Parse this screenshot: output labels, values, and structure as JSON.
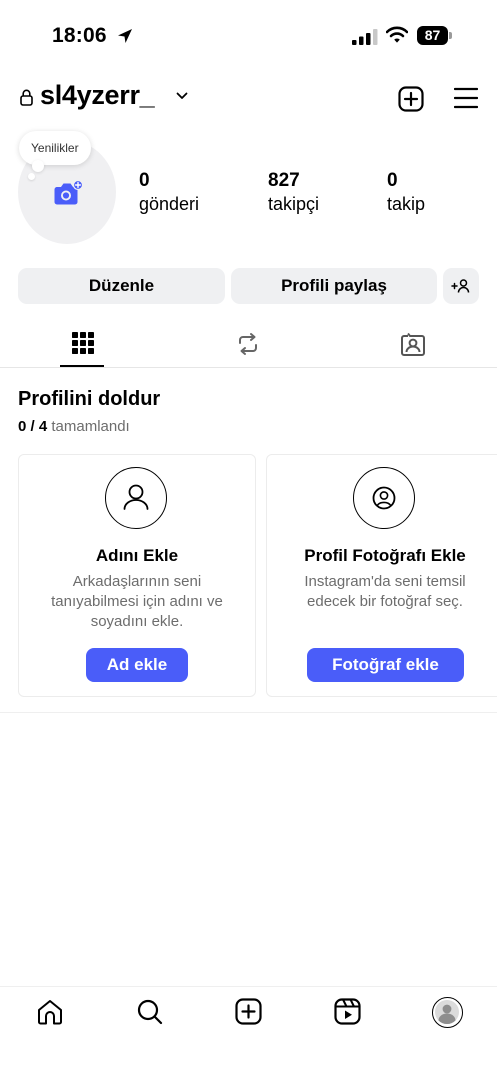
{
  "status_bar": {
    "time": "18:06",
    "battery": "87"
  },
  "header": {
    "username": "sl4yzerr_"
  },
  "profile": {
    "bubble_text": "Yenilikler",
    "stats": [
      {
        "value": "0",
        "label": "gönderi"
      },
      {
        "value": "827",
        "label": "takipçi"
      },
      {
        "value": "0",
        "label": "takip"
      }
    ]
  },
  "actions": {
    "edit_label": "Düzenle",
    "share_label": "Profili paylaş"
  },
  "tabs": [
    {
      "icon": "grid-icon",
      "active": true
    },
    {
      "icon": "reposts-icon",
      "active": false
    },
    {
      "icon": "tagged-icon",
      "active": false
    }
  ],
  "complete_profile": {
    "title": "Profilini doldur",
    "progress_count": "0 / 4",
    "progress_text": "tamamlandı",
    "cards": [
      {
        "title": "Adını Ekle",
        "lines": [
          "Arkadaşlarının seni",
          "tanıyabilmesi için adını ve",
          "soyadını ekle."
        ],
        "button": "Ad ekle"
      },
      {
        "title": "Profil Fotoğrafı Ekle",
        "lines": [
          "Instagram'da seni temsil",
          "edecek bir fotoğraf seç."
        ],
        "button": "Fotoğraf ekle"
      }
    ]
  },
  "bottom_nav": [
    "home-icon",
    "search-icon",
    "create-icon",
    "reels-icon",
    "profile-icon"
  ],
  "colors": {
    "accent": "#4a5df9",
    "button_bg": "#eff0f2",
    "muted_text": "#6d6d6d"
  }
}
